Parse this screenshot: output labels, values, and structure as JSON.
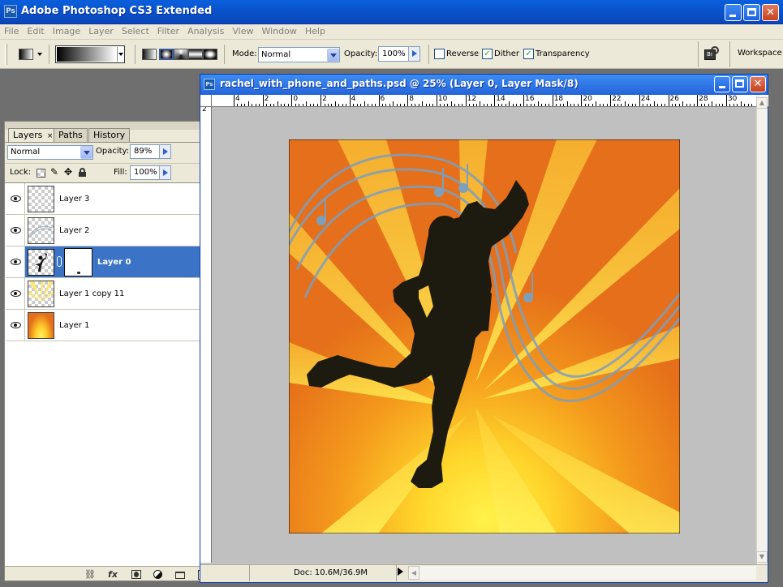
{
  "app": {
    "title": "Adobe Photoshop CS3 Extended",
    "icon_text": "Ps"
  },
  "menu": [
    "File",
    "Edit",
    "Image",
    "Layer",
    "Select",
    "Filter",
    "Analysis",
    "View",
    "Window",
    "Help"
  ],
  "options": {
    "mode_label": "Mode:",
    "mode_value": "Normal",
    "opacity_label": "Opacity:",
    "opacity_value": "100%",
    "reverse_label": "Reverse",
    "reverse_checked": false,
    "dither_label": "Dither",
    "dither_checked": true,
    "transparency_label": "Transparency",
    "transparency_checked": true,
    "workspace_label": "Workspace"
  },
  "layers_panel": {
    "tabs": [
      "Layers",
      "Paths",
      "History"
    ],
    "active_tab": "Layers",
    "blend_mode": "Normal",
    "opacity_label": "Opacity:",
    "opacity_value": "89%",
    "lock_label": "Lock:",
    "fill_label": "Fill:",
    "fill_value": "100%",
    "layers": [
      {
        "name": "Layer 3",
        "visible": true,
        "selected": false
      },
      {
        "name": "Layer 2",
        "visible": true,
        "selected": false
      },
      {
        "name": "Layer 0",
        "visible": true,
        "selected": true,
        "has_mask": true
      },
      {
        "name": "Layer 1 copy 11",
        "visible": true,
        "selected": false
      },
      {
        "name": "Layer 1",
        "visible": true,
        "selected": false
      }
    ]
  },
  "document": {
    "title": "rachel_with_phone_and_paths.psd @ 25% (Layer 0, Layer Mask/8)",
    "doc_size": "Doc: 10.6M/36.9M",
    "ruler_labels": [
      "4",
      "2",
      "0",
      "2",
      "4",
      "6",
      "8",
      "10",
      "12",
      "14",
      "16",
      "18",
      "20",
      "22",
      "24",
      "26",
      "28",
      "30"
    ],
    "vruler_label": "2"
  },
  "colors": {
    "xp_blue": "#0a55d6",
    "selection": "#3b74c6",
    "canvas_orange": "#e56f1a",
    "ray_yellow": "#ffd23a"
  }
}
